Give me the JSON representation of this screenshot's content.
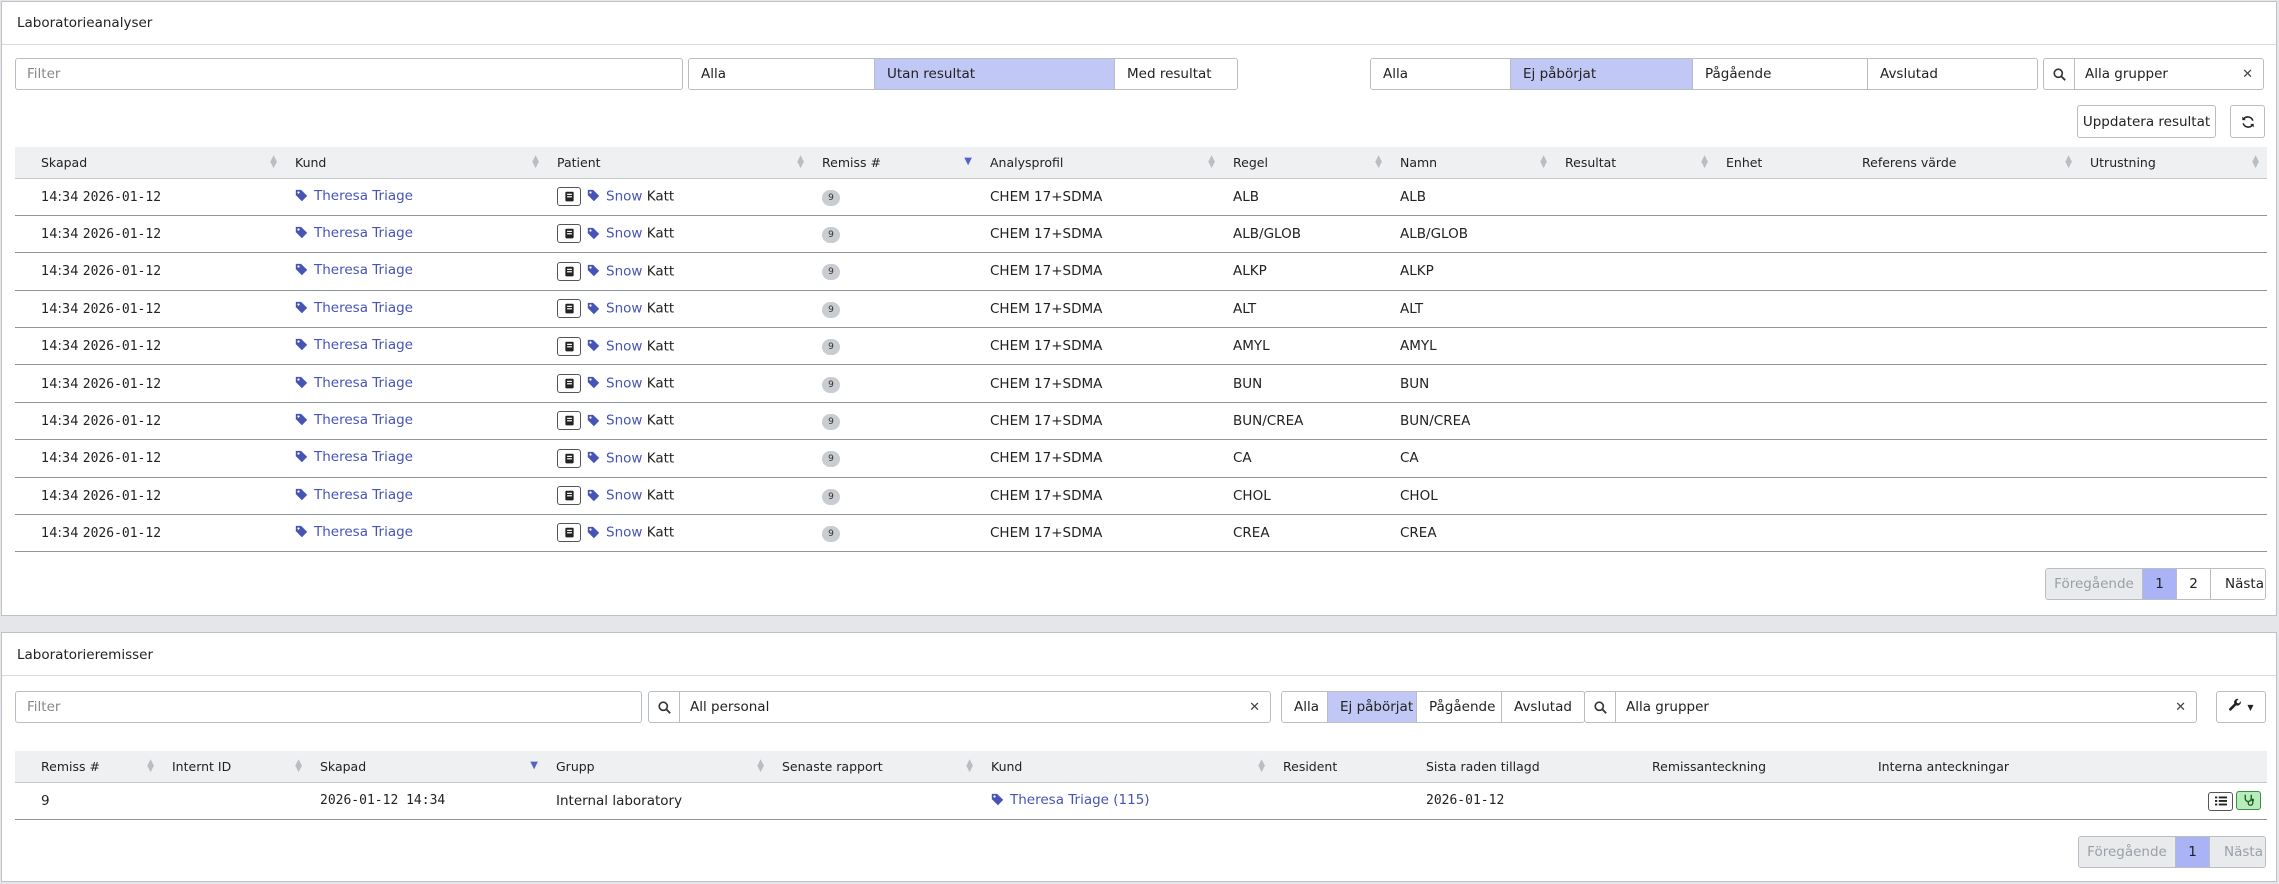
{
  "analyses": {
    "title": "Laboratorieanalyser",
    "filter_placeholder": "Filter",
    "result_filter": [
      "Alla",
      "Utan resultat",
      "Med resultat"
    ],
    "result_filter_active": 1,
    "status_filter": [
      "Alla",
      "Ej påbörjat",
      "Pågående",
      "Avslutad"
    ],
    "status_filter_active": 1,
    "group_select": "Alla grupper",
    "update_button": "Uppdatera resultat",
    "columns": [
      "Skapad",
      "Kund",
      "Patient",
      "Remiss #",
      "Analysprofil",
      "Regel",
      "Namn",
      "Resultat",
      "Enhet",
      "Referens värde",
      "Utrustning"
    ],
    "rows": [
      {
        "time": "14:34",
        "date": "2026-01-12",
        "customer": "Theresa Triage",
        "patient_first": "Snow",
        "patient_last": "Katt",
        "remiss": "9",
        "profile": "CHEM 17+SDMA",
        "rule": "ALB",
        "name": "ALB"
      },
      {
        "time": "14:34",
        "date": "2026-01-12",
        "customer": "Theresa Triage",
        "patient_first": "Snow",
        "patient_last": "Katt",
        "remiss": "9",
        "profile": "CHEM 17+SDMA",
        "rule": "ALB/GLOB",
        "name": "ALB/GLOB"
      },
      {
        "time": "14:34",
        "date": "2026-01-12",
        "customer": "Theresa Triage",
        "patient_first": "Snow",
        "patient_last": "Katt",
        "remiss": "9",
        "profile": "CHEM 17+SDMA",
        "rule": "ALKP",
        "name": "ALKP"
      },
      {
        "time": "14:34",
        "date": "2026-01-12",
        "customer": "Theresa Triage",
        "patient_first": "Snow",
        "patient_last": "Katt",
        "remiss": "9",
        "profile": "CHEM 17+SDMA",
        "rule": "ALT",
        "name": "ALT"
      },
      {
        "time": "14:34",
        "date": "2026-01-12",
        "customer": "Theresa Triage",
        "patient_first": "Snow",
        "patient_last": "Katt",
        "remiss": "9",
        "profile": "CHEM 17+SDMA",
        "rule": "AMYL",
        "name": "AMYL"
      },
      {
        "time": "14:34",
        "date": "2026-01-12",
        "customer": "Theresa Triage",
        "patient_first": "Snow",
        "patient_last": "Katt",
        "remiss": "9",
        "profile": "CHEM 17+SDMA",
        "rule": "BUN",
        "name": "BUN"
      },
      {
        "time": "14:34",
        "date": "2026-01-12",
        "customer": "Theresa Triage",
        "patient_first": "Snow",
        "patient_last": "Katt",
        "remiss": "9",
        "profile": "CHEM 17+SDMA",
        "rule": "BUN/CREA",
        "name": "BUN/CREA"
      },
      {
        "time": "14:34",
        "date": "2026-01-12",
        "customer": "Theresa Triage",
        "patient_first": "Snow",
        "patient_last": "Katt",
        "remiss": "9",
        "profile": "CHEM 17+SDMA",
        "rule": "CA",
        "name": "CA"
      },
      {
        "time": "14:34",
        "date": "2026-01-12",
        "customer": "Theresa Triage",
        "patient_first": "Snow",
        "patient_last": "Katt",
        "remiss": "9",
        "profile": "CHEM 17+SDMA",
        "rule": "CHOL",
        "name": "CHOL"
      },
      {
        "time": "14:34",
        "date": "2026-01-12",
        "customer": "Theresa Triage",
        "patient_first": "Snow",
        "patient_last": "Katt",
        "remiss": "9",
        "profile": "CHEM 17+SDMA",
        "rule": "CREA",
        "name": "CREA"
      }
    ],
    "pager": [
      "Föregående",
      "1",
      "2",
      "Nästa"
    ]
  },
  "referrals": {
    "title": "Laboratorieremisser",
    "filter_placeholder": "Filter",
    "personnel_select": "All personal",
    "status_filter": [
      "Alla",
      "Ej påbörjat",
      "Pågående",
      "Avslutad"
    ],
    "status_filter_active": 1,
    "group_select": "Alla grupper",
    "columns": [
      "Remiss #",
      "Internt ID",
      "Skapad",
      "Grupp",
      "Senaste rapport",
      "Kund",
      "Resident",
      "Sista raden tillagd",
      "Remissanteckning",
      "Interna anteckningar"
    ],
    "rows": [
      {
        "remiss": "9",
        "internal_id": "",
        "created": "2026-01-12 14:34",
        "group": "Internal laboratory",
        "latest_report": "",
        "customer": "Theresa Triage (115)",
        "resident": "",
        "last_row_added": "2026-01-12",
        "remiss_note": "",
        "internal_notes": ""
      }
    ],
    "pager": [
      "Föregående",
      "1",
      "Nästa"
    ]
  },
  "icons": {
    "search": "search-icon",
    "clear": "clear-icon",
    "refresh": "refresh-icon",
    "tag": "tag-icon",
    "patient_card": "patient-card-icon",
    "wrench": "wrench-icon",
    "list": "list-icon",
    "stethoscope": "stethoscope-icon"
  },
  "colors": {
    "active_segment": "#c2c8f5",
    "link": "#4654b5",
    "pager_active": "#a9b3f5",
    "green_button": "#b9ecbd"
  }
}
